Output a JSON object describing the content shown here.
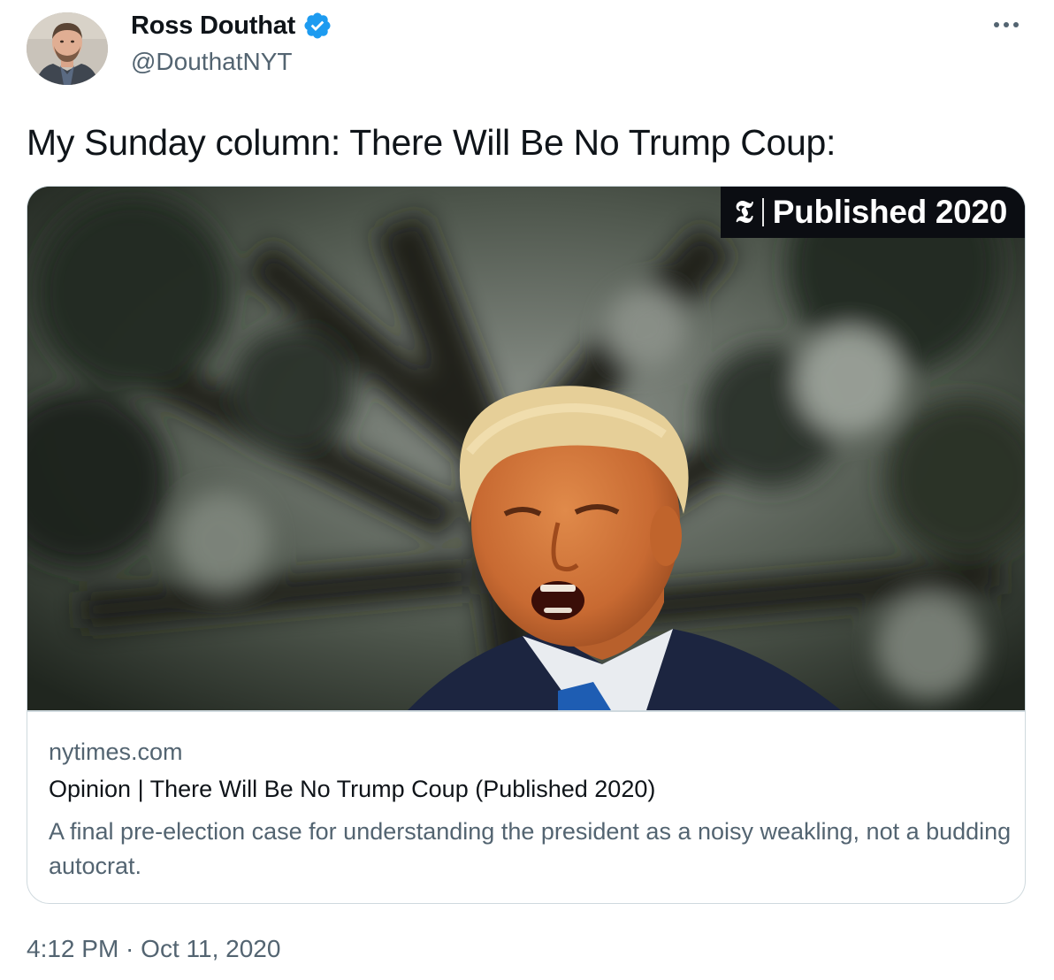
{
  "author": {
    "display_name": "Ross Douthat",
    "handle": "@DouthatNYT",
    "verified": true,
    "avatar_icon": "user-avatar-photo"
  },
  "tweet": {
    "text": "My Sunday column: There Will Be No Trump Coup:",
    "timestamp": "4:12 PM · Oct 11, 2020"
  },
  "card": {
    "image_badge_logo": "𝕿",
    "image_badge_text": "Published 2020",
    "domain": "nytimes.com",
    "title": "Opinion | There Will Be No Trump Coup (Published 2020)",
    "description": "A final pre-election case for understanding the president as a noisy weakling, not a budding autocrat."
  },
  "icons": {
    "verified": "verified-badge-icon",
    "more": "more-options-icon"
  },
  "colors": {
    "text_primary": "#0f1419",
    "text_secondary": "#536471",
    "verified_blue": "#1d9bf0",
    "card_border": "#cfd9de"
  }
}
